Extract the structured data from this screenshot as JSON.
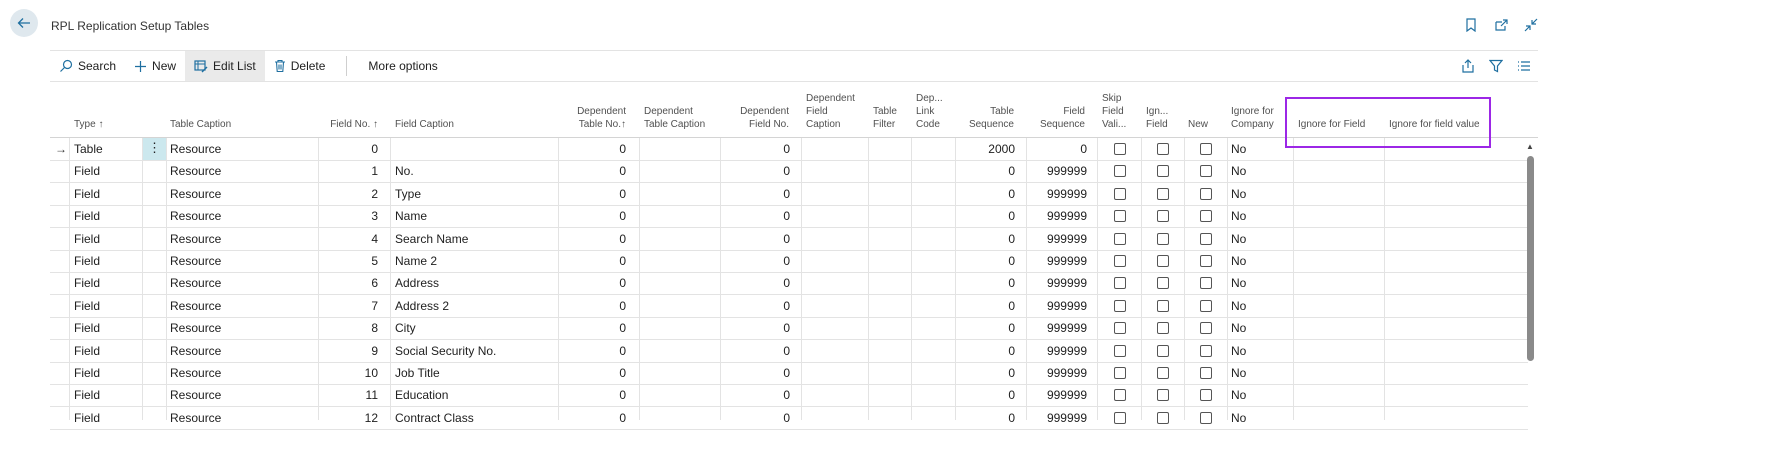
{
  "page": {
    "title": "RPL Replication Setup Tables"
  },
  "header_icons": [
    "bookmark-icon",
    "open-new-window-icon",
    "collapse-icon"
  ],
  "toolbar": {
    "search": "Search",
    "new": "New",
    "edit_list": "Edit List",
    "delete": "Delete",
    "more": "More options"
  },
  "columns": {
    "type": "Type",
    "table_caption": "Table Caption",
    "field_no": "Field No.",
    "field_caption": "Field Caption",
    "dep_table_no": "Dependent\nTable No.",
    "dep_table_caption": "Dependent\nTable Caption",
    "dep_field_no": "Dependent\nField No.",
    "dep_field_caption": "Dependent\nField\nCaption",
    "table_filter": "Table\nFilter",
    "dep_link_code": "Dep...\nLink\nCode",
    "table_sequence": "Table\nSequence",
    "field_sequence": "Field\nSequence",
    "skip_field_val": "Skip\nField\nVali...",
    "ign_field": "Ign...\nField",
    "new": "New",
    "ignore_for_company": "Ignore for\nCompany",
    "ignore_for_field": "Ignore for Field",
    "ignore_for_field_value": "Ignore for field value"
  },
  "sort_arrow": "↑",
  "rows": [
    {
      "type": "Table",
      "table_caption": "Resource",
      "field_no": "0",
      "field_caption": "",
      "dep_table_no": "0",
      "dep_field_no": "0",
      "table_sequence": "2000",
      "field_sequence": "0",
      "ignore_for_company": "No"
    },
    {
      "type": "Field",
      "table_caption": "Resource",
      "field_no": "1",
      "field_caption": "No.",
      "dep_table_no": "0",
      "dep_field_no": "0",
      "table_sequence": "0",
      "field_sequence": "999999",
      "ignore_for_company": "No"
    },
    {
      "type": "Field",
      "table_caption": "Resource",
      "field_no": "2",
      "field_caption": "Type",
      "dep_table_no": "0",
      "dep_field_no": "0",
      "table_sequence": "0",
      "field_sequence": "999999",
      "ignore_for_company": "No"
    },
    {
      "type": "Field",
      "table_caption": "Resource",
      "field_no": "3",
      "field_caption": "Name",
      "dep_table_no": "0",
      "dep_field_no": "0",
      "table_sequence": "0",
      "field_sequence": "999999",
      "ignore_for_company": "No"
    },
    {
      "type": "Field",
      "table_caption": "Resource",
      "field_no": "4",
      "field_caption": "Search Name",
      "dep_table_no": "0",
      "dep_field_no": "0",
      "table_sequence": "0",
      "field_sequence": "999999",
      "ignore_for_company": "No"
    },
    {
      "type": "Field",
      "table_caption": "Resource",
      "field_no": "5",
      "field_caption": "Name 2",
      "dep_table_no": "0",
      "dep_field_no": "0",
      "table_sequence": "0",
      "field_sequence": "999999",
      "ignore_for_company": "No"
    },
    {
      "type": "Field",
      "table_caption": "Resource",
      "field_no": "6",
      "field_caption": "Address",
      "dep_table_no": "0",
      "dep_field_no": "0",
      "table_sequence": "0",
      "field_sequence": "999999",
      "ignore_for_company": "No"
    },
    {
      "type": "Field",
      "table_caption": "Resource",
      "field_no": "7",
      "field_caption": "Address 2",
      "dep_table_no": "0",
      "dep_field_no": "0",
      "table_sequence": "0",
      "field_sequence": "999999",
      "ignore_for_company": "No"
    },
    {
      "type": "Field",
      "table_caption": "Resource",
      "field_no": "8",
      "field_caption": "City",
      "dep_table_no": "0",
      "dep_field_no": "0",
      "table_sequence": "0",
      "field_sequence": "999999",
      "ignore_for_company": "No"
    },
    {
      "type": "Field",
      "table_caption": "Resource",
      "field_no": "9",
      "field_caption": "Social Security No.",
      "dep_table_no": "0",
      "dep_field_no": "0",
      "table_sequence": "0",
      "field_sequence": "999999",
      "ignore_for_company": "No"
    },
    {
      "type": "Field",
      "table_caption": "Resource",
      "field_no": "10",
      "field_caption": "Job Title",
      "dep_table_no": "0",
      "dep_field_no": "0",
      "table_sequence": "0",
      "field_sequence": "999999",
      "ignore_for_company": "No"
    },
    {
      "type": "Field",
      "table_caption": "Resource",
      "field_no": "11",
      "field_caption": "Education",
      "dep_table_no": "0",
      "dep_field_no": "0",
      "table_sequence": "0",
      "field_sequence": "999999",
      "ignore_for_company": "No"
    },
    {
      "type": "Field",
      "table_caption": "Resource",
      "field_no": "12",
      "field_caption": "Contract Class",
      "dep_table_no": "0",
      "dep_field_no": "0",
      "table_sequence": "0",
      "field_sequence": "999999",
      "ignore_for_company": "No"
    }
  ],
  "colors": {
    "highlight": "#9c27e6",
    "selected_cell": "#cce8ee",
    "back_button": "#dfe8ee"
  }
}
